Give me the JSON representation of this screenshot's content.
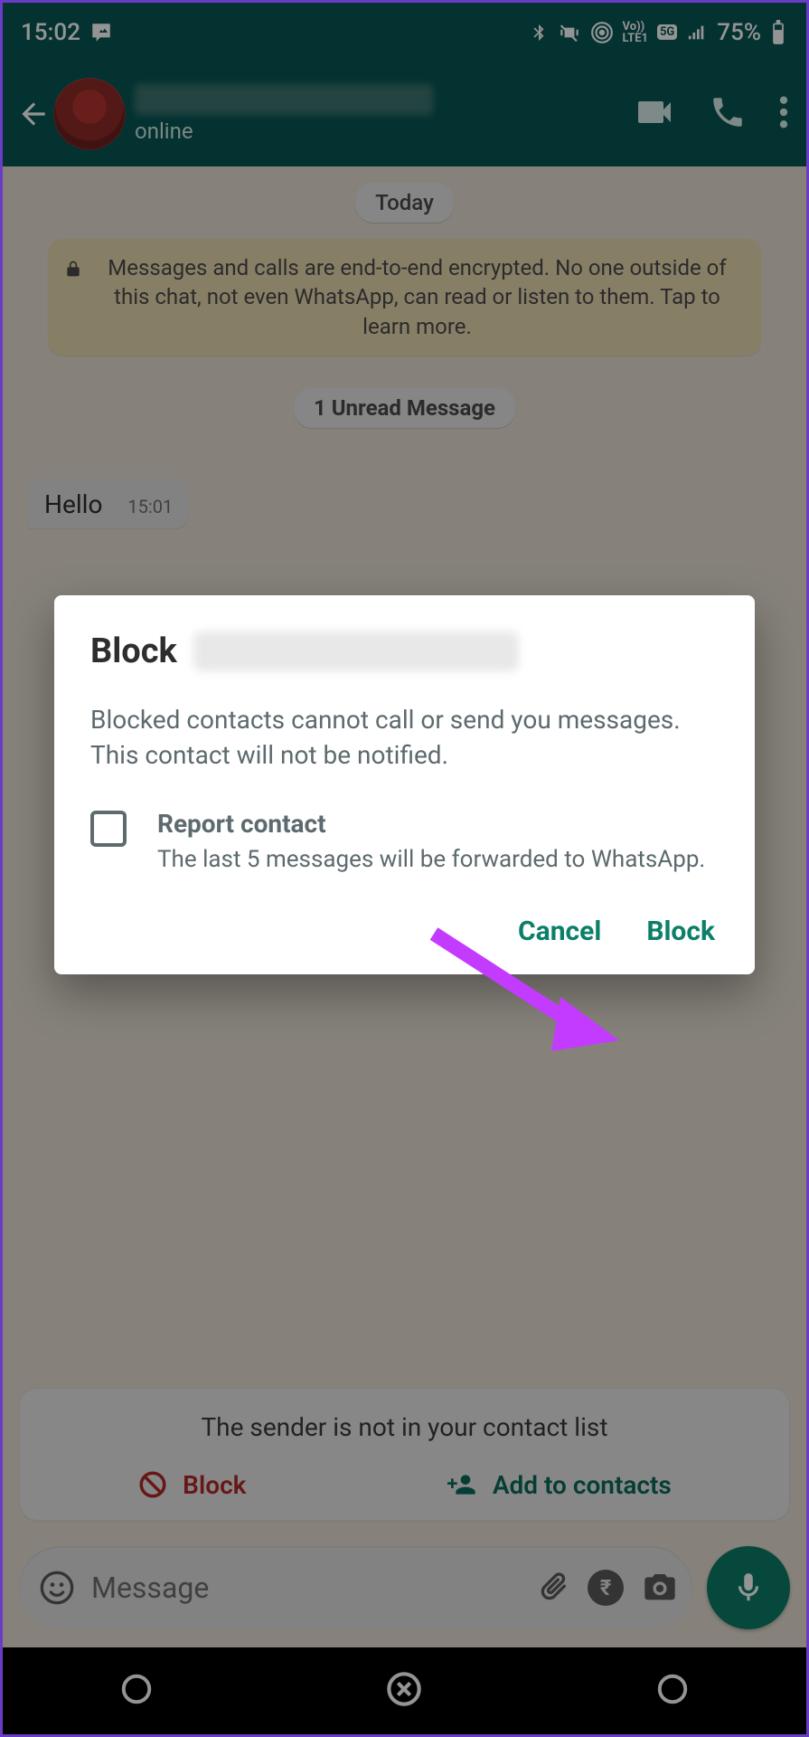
{
  "status": {
    "time": "15:02",
    "battery": "75%"
  },
  "appbar": {
    "presence": "online"
  },
  "chat": {
    "date_chip": "Today",
    "encryption_notice": "Messages and calls are end-to-end encrypted. No one outside of this chat, not even WhatsApp, can read or listen to them. Tap to learn more.",
    "unread_chip": "1 Unread Message",
    "messages": [
      {
        "text": "Hello",
        "time": "15:01"
      }
    ]
  },
  "unknown_sender": {
    "title": "The sender is not in your contact list",
    "block_label": "Block",
    "add_label": "Add to contacts"
  },
  "input": {
    "placeholder": "Message"
  },
  "dialog": {
    "title_prefix": "Block",
    "description": "Blocked contacts cannot call or send you messages. This contact will not be notified.",
    "report_label": "Report contact",
    "report_sub": "The last 5 messages will be forwarded to WhatsApp.",
    "cancel": "Cancel",
    "confirm": "Block"
  }
}
